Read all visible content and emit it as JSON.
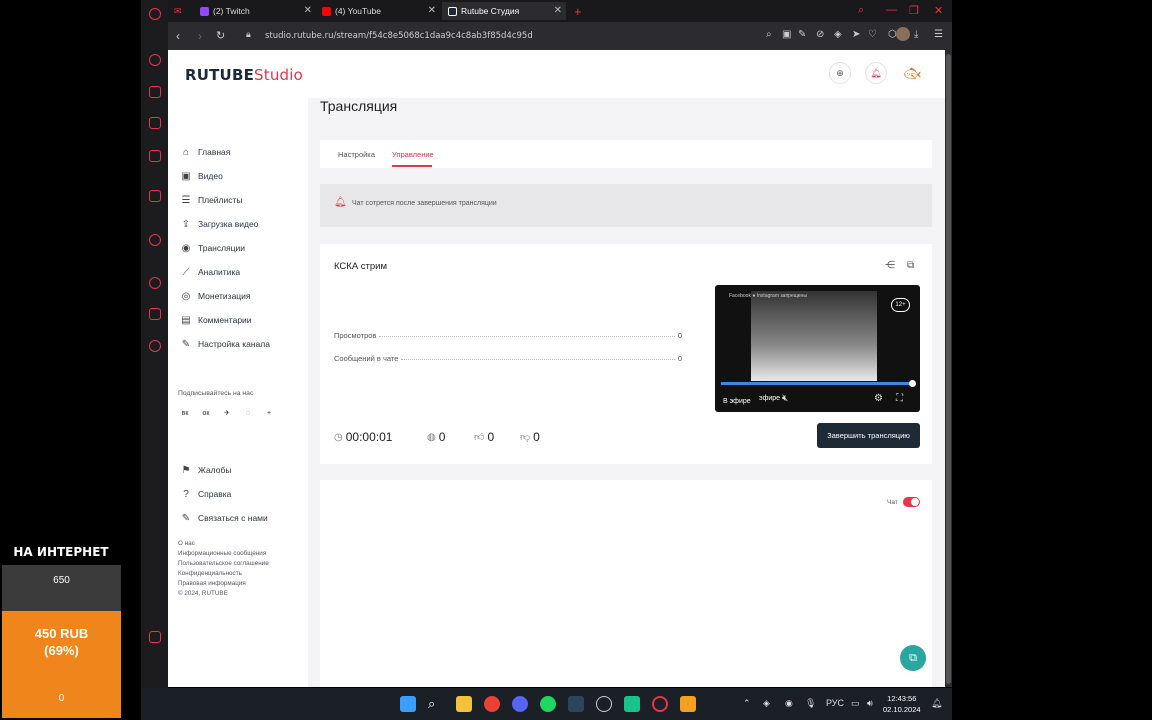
{
  "overlay": {
    "title": "НА ИНТЕРНЕТ",
    "count": "650",
    "amount_line1": "450 RUB",
    "amount_line2": "(69%)",
    "bottom_value": "0",
    "progress_fraction": 0.69
  },
  "browser": {
    "tabs": [
      {
        "label": "(2) Twitch",
        "color": "#9146ff"
      },
      {
        "label": "(4) YouTube",
        "color": "#ff0000"
      },
      {
        "label": "Rutube Студия",
        "color": "#1a2a3a"
      }
    ],
    "new_tab_label": "+",
    "url": "studio.rutube.ru/stream/f54c8e5068c1daa9c4c8ab3f85d4c95d"
  },
  "header": {
    "logo_main": "RUTUBE",
    "logo_sub": "Studio"
  },
  "sidebar": {
    "items": [
      {
        "label": "Главная",
        "icon": "home-icon",
        "glyph": "⌂"
      },
      {
        "label": "Видео",
        "icon": "video-icon",
        "glyph": "▣"
      },
      {
        "label": "Плейлисты",
        "icon": "playlist-icon",
        "glyph": "☰"
      },
      {
        "label": "Загрузка видео",
        "icon": "upload-icon",
        "glyph": "⇪"
      },
      {
        "label": "Трансляции",
        "icon": "broadcast-icon",
        "glyph": "◉"
      },
      {
        "label": "Аналитика",
        "icon": "analytics-icon",
        "glyph": "⟋"
      },
      {
        "label": "Монетизация",
        "icon": "money-icon",
        "glyph": "◎"
      },
      {
        "label": "Комментарии",
        "icon": "comments-icon",
        "glyph": "▤"
      },
      {
        "label": "Настройка канала",
        "icon": "settings-icon",
        "glyph": "✎"
      }
    ],
    "subscribe_label": "Подписывайтесь на нас",
    "social": [
      "вк",
      "ок",
      "✈",
      "◌",
      "+"
    ],
    "support": [
      {
        "label": "Жалобы",
        "icon": "flag-icon",
        "glyph": "⚑"
      },
      {
        "label": "Справка",
        "icon": "help-icon",
        "glyph": "?"
      },
      {
        "label": "Связаться с нами",
        "icon": "contact-icon",
        "glyph": "✎"
      }
    ],
    "footer": [
      "О нас",
      "Информационные сообщения",
      "Пользовательское соглашение",
      "Конфиденциальность",
      "Правовая информация",
      "© 2024, RUTUBE"
    ]
  },
  "main": {
    "title": "Трансляция",
    "tabs": [
      "Настройка",
      "Управление"
    ],
    "notice": "Чат сотрется после завершения трансляции",
    "stream": {
      "title": "КСКА стрим",
      "views_label": "Просмотров",
      "views_value": "0",
      "messages_label": "Сообщений в чате",
      "messages_value": "0",
      "timer": "00:00:01",
      "viewers": "0",
      "likes": "0",
      "dislikes": "0",
      "end_button": "Завершить трансляцию",
      "video": {
        "age": "12+",
        "live_label": "В эфире",
        "overlay_label": "эфире",
        "banner": "Facebook ● Instagram запрещены"
      }
    },
    "chat_label": "Чат"
  },
  "taskbar": {
    "lang": "РУС",
    "time": "12:43:56",
    "date": "02.10.2024"
  }
}
